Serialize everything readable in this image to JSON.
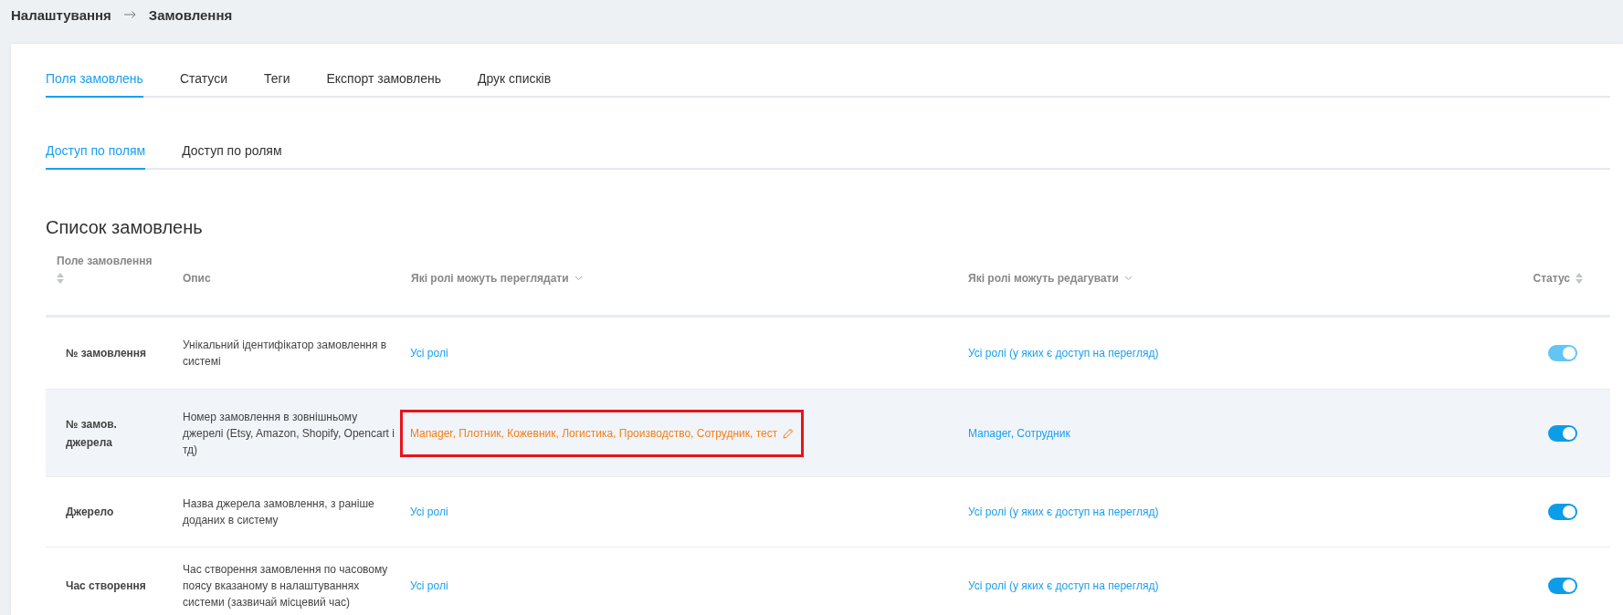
{
  "breadcrumb": {
    "items": [
      "Налаштування",
      "Замовлення"
    ]
  },
  "tabs": [
    {
      "label": "Поля замовлень",
      "selected": true
    },
    {
      "label": "Статуси",
      "selected": false
    },
    {
      "label": "Теги",
      "selected": false
    },
    {
      "label": "Експорт замовлень",
      "selected": false
    },
    {
      "label": "Друк списків",
      "selected": false
    }
  ],
  "subtabs": [
    {
      "label": "Доступ по полям",
      "selected": true
    },
    {
      "label": "Доступ по ролям",
      "selected": false
    }
  ],
  "section_title": "Список замовлень",
  "table": {
    "columns": [
      {
        "label": "Поле замовлення",
        "kind": "sortable"
      },
      {
        "label": "Опис",
        "kind": "plain"
      },
      {
        "label": "Які ролі можуть переглядати",
        "kind": "filter"
      },
      {
        "label": "Які ролі можуть редагувати",
        "kind": "filter"
      },
      {
        "label": "Статус",
        "kind": "sortable"
      }
    ],
    "rows": [
      {
        "field": "№ замовлення",
        "description": "Унікальний ідентифікатор замовлення в системі",
        "view_roles": "Усі ролі",
        "view_editing": false,
        "view_marked": false,
        "edit_roles": "Усі ролі (у яких є доступ на перегляд)",
        "hovered": false,
        "status_on": true,
        "status_disabled": true
      },
      {
        "field": "№ замов. джерела",
        "description": "Номер замовлення в зовнішньому джерелі (Etsy, Amazon, Shopify, Opencart і тд)",
        "view_roles": "Manager, Плотник, Кожевник, Логистика, Производство, Сотрудник, тест",
        "view_editing": true,
        "view_marked": true,
        "edit_roles": "Manager, Сотрудник",
        "hovered": true,
        "status_on": true,
        "status_disabled": false
      },
      {
        "field": "Джерело",
        "description": "Назва джерела замовлення, з раніше доданих в систему",
        "view_roles": "Усі ролі",
        "view_editing": false,
        "view_marked": false,
        "edit_roles": "Усі ролі (у яких є доступ на перегляд)",
        "hovered": false,
        "status_on": true,
        "status_disabled": false
      },
      {
        "field": "Час створення",
        "description": "Час створення замовлення по часовому поясу вказаному в налаштуваннях системи (зазвичай місцевий час)",
        "view_roles": "Усі ролі",
        "view_editing": false,
        "view_marked": false,
        "edit_roles": "Усі ролі (у яких є доступ на перегляд)",
        "hovered": false,
        "status_on": true,
        "status_disabled": false
      }
    ]
  }
}
